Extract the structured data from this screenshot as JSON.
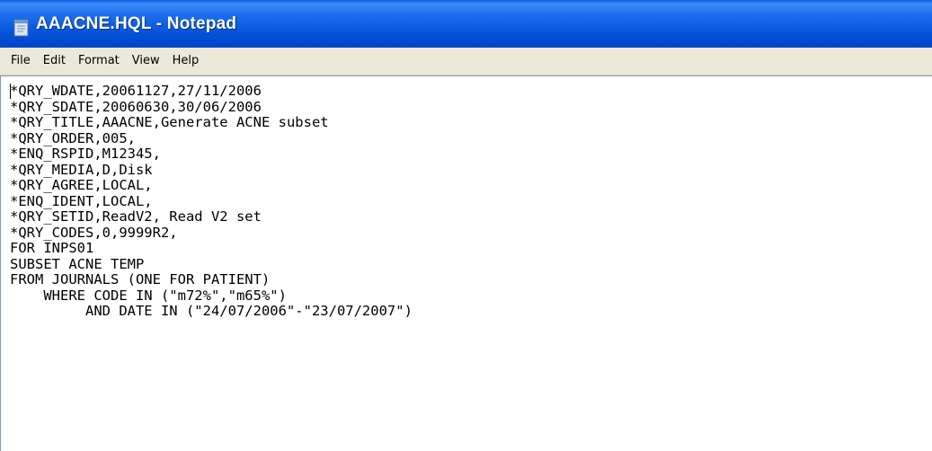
{
  "window": {
    "title": "AAACNE.HQL - Notepad",
    "icon": "notepad-icon"
  },
  "menu": {
    "items": [
      {
        "label": "File"
      },
      {
        "label": "Edit"
      },
      {
        "label": "Format"
      },
      {
        "label": "View"
      },
      {
        "label": "Help"
      }
    ]
  },
  "editor": {
    "lines": [
      "*QRY_WDATE,20061127,27/11/2006",
      "*QRY_SDATE,20060630,30/06/2006",
      "*QRY_TITLE,AAACNE,Generate ACNE subset",
      "*QRY_ORDER,005,",
      "*ENQ_RSPID,M12345,",
      "*QRY_MEDIA,D,Disk",
      "*QRY_AGREE,LOCAL,",
      "*ENQ_IDENT,LOCAL,",
      "*QRY_SETID,ReadV2, Read V2 set",
      "*QRY_CODES,0,9999R2,",
      "FOR INPS01",
      "SUBSET ACNE TEMP",
      "FROM JOURNALS (ONE FOR PATIENT)",
      "    WHERE CODE IN (\"m72%\",\"m65%\")",
      "         AND DATE IN (\"24/07/2006\"-\"23/07/2007\")"
    ]
  },
  "colors": {
    "titlebar": "#0553d9",
    "menubar": "#ece9d8",
    "editor_bg": "#ffffff",
    "text": "#000000"
  }
}
